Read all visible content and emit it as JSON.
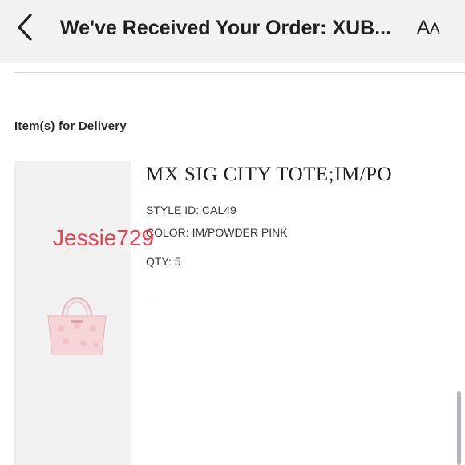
{
  "header": {
    "title": "We've Received Your Order: XUB...",
    "text_size_label_large": "A",
    "text_size_label_small": "A",
    "back_icon": "chevron-left-icon"
  },
  "section": {
    "heading": "Item(s) for Delivery"
  },
  "item": {
    "name": "MX SIG CITY TOTE;IM/PO",
    "style_id": "STYLE ID: CAL49",
    "color": "COLOR: IM/POWDER PINK",
    "qty": "QTY: 5",
    "image_icon": "pink-signature-tote-bag"
  },
  "watermark": {
    "text": "Jessie729"
  },
  "colors": {
    "header_bg": "#f2f2f4",
    "watermark": "#e8414f",
    "product_panel_bg": "#f1f1f1",
    "bag_pink": "#f4d3d6"
  }
}
